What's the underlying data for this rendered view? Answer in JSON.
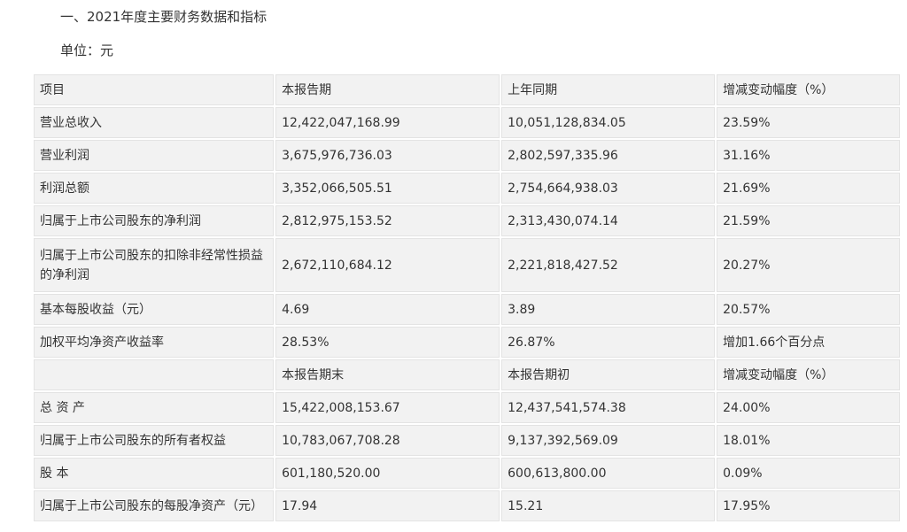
{
  "heading": "一、2021年度主要财务数据和指标",
  "unit": "单位：元",
  "header": [
    "项目",
    "本报告期",
    "上年同期",
    "增减变动幅度（%）"
  ],
  "rows_a": [
    [
      "营业总收入",
      "12,422,047,168.99",
      "10,051,128,834.05",
      "23.59%"
    ],
    [
      "营业利润",
      "3,675,976,736.03",
      "2,802,597,335.96",
      "31.16%"
    ],
    [
      "利润总额",
      "3,352,066,505.51",
      "2,754,664,938.03",
      "21.69%"
    ],
    [
      "归属于上市公司股东的净利润",
      "2,812,975,153.52",
      "2,313,430,074.14",
      "21.59%"
    ],
    [
      "归属于上市公司股东的扣除非经常性损益的净利润",
      "2,672,110,684.12",
      "2,221,818,427.52",
      "20.27%"
    ],
    [
      "基本每股收益（元）",
      "4.69",
      "3.89",
      "20.57%"
    ],
    [
      "加权平均净资产收益率",
      "28.53%",
      "26.87%",
      "增加1.66个百分点"
    ]
  ],
  "header_b": [
    "",
    "本报告期末",
    "本报告期初",
    "增减变动幅度（%）"
  ],
  "rows_b": [
    [
      "总 资 产",
      "15,422,008,153.67",
      "12,437,541,574.38",
      "24.00%"
    ],
    [
      "归属于上市公司股东的所有者权益",
      "10,783,067,708.28",
      "9,137,392,569.09",
      "18.01%"
    ],
    [
      "股 本",
      "601,180,520.00",
      "600,613,800.00",
      "0.09%"
    ],
    [
      "归属于上市公司股东的每股净资产（元）",
      "17.94",
      "15.21",
      "17.95%"
    ]
  ]
}
